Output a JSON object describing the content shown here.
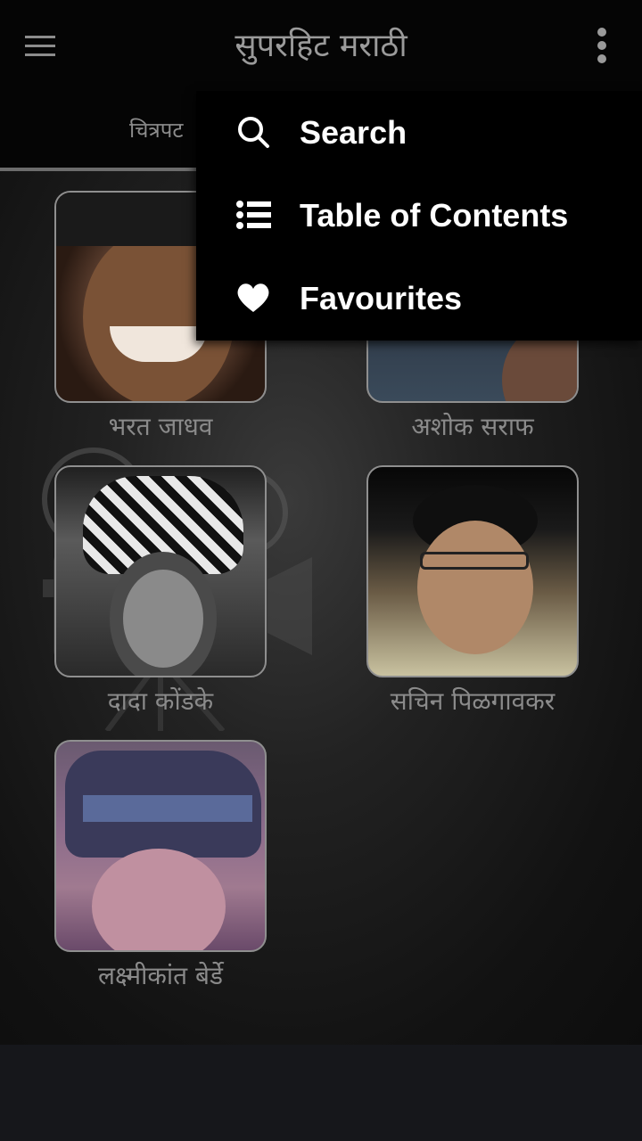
{
  "toolbar": {
    "title": "सुपरहिट मराठी",
    "menu_icon": "hamburger-menu-icon",
    "overflow_icon": "more-vertical-icon"
  },
  "tabs": {
    "active_label": "चित्रपट"
  },
  "actors": [
    {
      "name": "भरत जाधव"
    },
    {
      "name": "अशोक सराफ"
    },
    {
      "name": "दादा कोंडके"
    },
    {
      "name": "सचिन पिळगावकर"
    },
    {
      "name": "लक्ष्मीकांत बेर्डे"
    }
  ],
  "overflow_menu": {
    "items": [
      {
        "label": "Search",
        "icon": "search-icon"
      },
      {
        "label": "Table of Contents",
        "icon": "list-icon"
      },
      {
        "label": "Favourites",
        "icon": "heart-icon"
      }
    ]
  },
  "colors": {
    "toolbar_bg": "#050505",
    "menu_bg": "#000000",
    "menu_text": "#ffffff",
    "muted_text": "#8a8a8a"
  }
}
